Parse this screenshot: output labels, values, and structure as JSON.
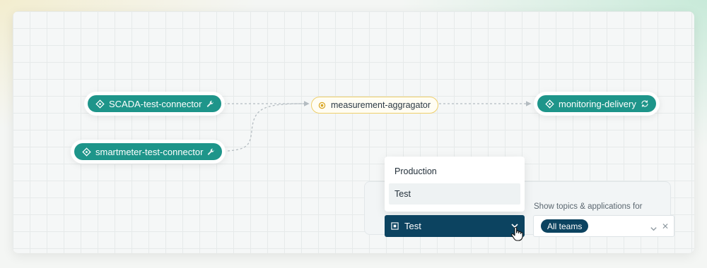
{
  "nodes": {
    "scada": {
      "label": "SCADA-test-connector",
      "icon": "connector-diamond-icon",
      "trail_icon": "wrench-icon"
    },
    "smartmeter": {
      "label": "smartmeter-test-connector",
      "icon": "connector-diamond-icon",
      "trail_icon": "wrench-icon"
    },
    "topic": {
      "label": "measurement-aggragator",
      "icon": "topic-dot-icon"
    },
    "monitoring": {
      "label": "monitoring-delivery",
      "icon": "connector-diamond-icon",
      "trail_icon": "sync-icon"
    }
  },
  "environment": {
    "options": [
      "Production",
      "Test"
    ],
    "selected": "Test"
  },
  "team_filter": {
    "label": "Show topics & applications for",
    "value": "All teams"
  },
  "colors": {
    "node_teal": "#1e958a",
    "topic_border": "#efcf6a",
    "select_navy": "#0c4360"
  }
}
